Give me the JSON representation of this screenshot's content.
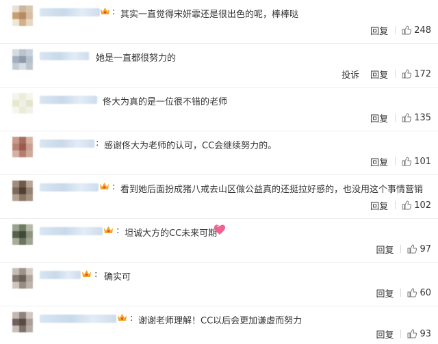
{
  "comments": [
    {
      "text": "其实一直觉得宋妍霏还是很出色的呢，棒棒哒",
      "has_crown": true,
      "has_colon": false,
      "reply": "回复",
      "likes": "248",
      "avatar_colors": [
        "#e8e0d6",
        "#cdb79a",
        "#d9c6ad",
        "#c79f72",
        "#b98a60",
        "#d8bda0",
        "#efe6db",
        "#d2b08c",
        "#e6d6c4"
      ]
    },
    {
      "text": "她是一直都很努力的",
      "has_crown": false,
      "has_colon": false,
      "report": "投诉",
      "reply": "回复",
      "likes": "172",
      "avatar_colors": [
        "#d5dbe1",
        "#b9c4cf",
        "#c9d2da",
        "#a2afbd",
        "#8e9aa8",
        "#b5c0cb",
        "#c3ccd5",
        "#d7dee5",
        "#bcc6d0"
      ]
    },
    {
      "text": "佟大为真的是一位很不错的老师",
      "has_crown": false,
      "has_colon": false,
      "reply": "回复",
      "likes": "135",
      "avatar_colors": [
        "#f4f4ea",
        "#ebecd9",
        "#f5f5ec",
        "#e7e8d2",
        "#f0f0e2",
        "#e3e5cc",
        "#f6f6ef",
        "#eaebd8",
        "#f1f1e6"
      ]
    },
    {
      "text": "感谢佟大为老师的认可，CC会继续努力的。",
      "has_crown": false,
      "has_colon": true,
      "reply": "回复",
      "likes": "101",
      "avatar_colors": [
        "#c79a8a",
        "#a56d5f",
        "#d8b3a3",
        "#b88272",
        "#9a5b4d",
        "#c9a090",
        "#d4b1a4",
        "#b47d6e",
        "#cfa898"
      ]
    },
    {
      "text": "看到她后面扮成猪八戒去山区做公益真的还挺拉好感的，也没用这个事情营销",
      "has_crown": true,
      "has_colon": true,
      "reply": "回复",
      "likes": "102",
      "avatar_colors": [
        "#a08d7c",
        "#6e5a4b",
        "#b7a594",
        "#7e6a58",
        "#4f3f33",
        "#948170",
        "#b3a08f",
        "#8a7664",
        "#a59281"
      ]
    },
    {
      "text": "坦诚大方的CC未来可期",
      "has_crown": true,
      "has_colon": true,
      "has_heart": true,
      "reply": "回复",
      "likes": "97",
      "avatar_colors": [
        "#9aa18e",
        "#6f7a63",
        "#b4b9a8",
        "#56604d",
        "#3f4a3a",
        "#8c9480",
        "#a6ad98",
        "#6a7460",
        "#9da591"
      ]
    },
    {
      "text": "确实可",
      "has_crown": true,
      "has_colon": true,
      "reply": "回复",
      "likes": "60",
      "avatar_colors": [
        "#c6bcb4",
        "#9f928a",
        "#d3cbc4",
        "#857870",
        "#6b5f59",
        "#b2a79f",
        "#cfc6bf",
        "#988c84",
        "#bdb3ab"
      ]
    },
    {
      "text": "谢谢老师理解！CC以后会更加谦虚而努力",
      "has_crown": true,
      "has_colon": true,
      "reply": "回复",
      "likes": "93",
      "avatar_colors": [
        "#c3b9b3",
        "#8f827b",
        "#d0c7c1",
        "#6f625c",
        "#574b46",
        "#a99d96",
        "#c8beb8",
        "#7d716a",
        "#b7aca5"
      ]
    }
  ],
  "icons": {
    "like": "thumbs-up-icon",
    "vip": "crown-icon",
    "emoji": "heart-emoji-icon"
  },
  "colors": {
    "text": "#333333",
    "crown": "#f5a623",
    "heart": "#f06292",
    "name_blur": "#c8d9ea"
  }
}
